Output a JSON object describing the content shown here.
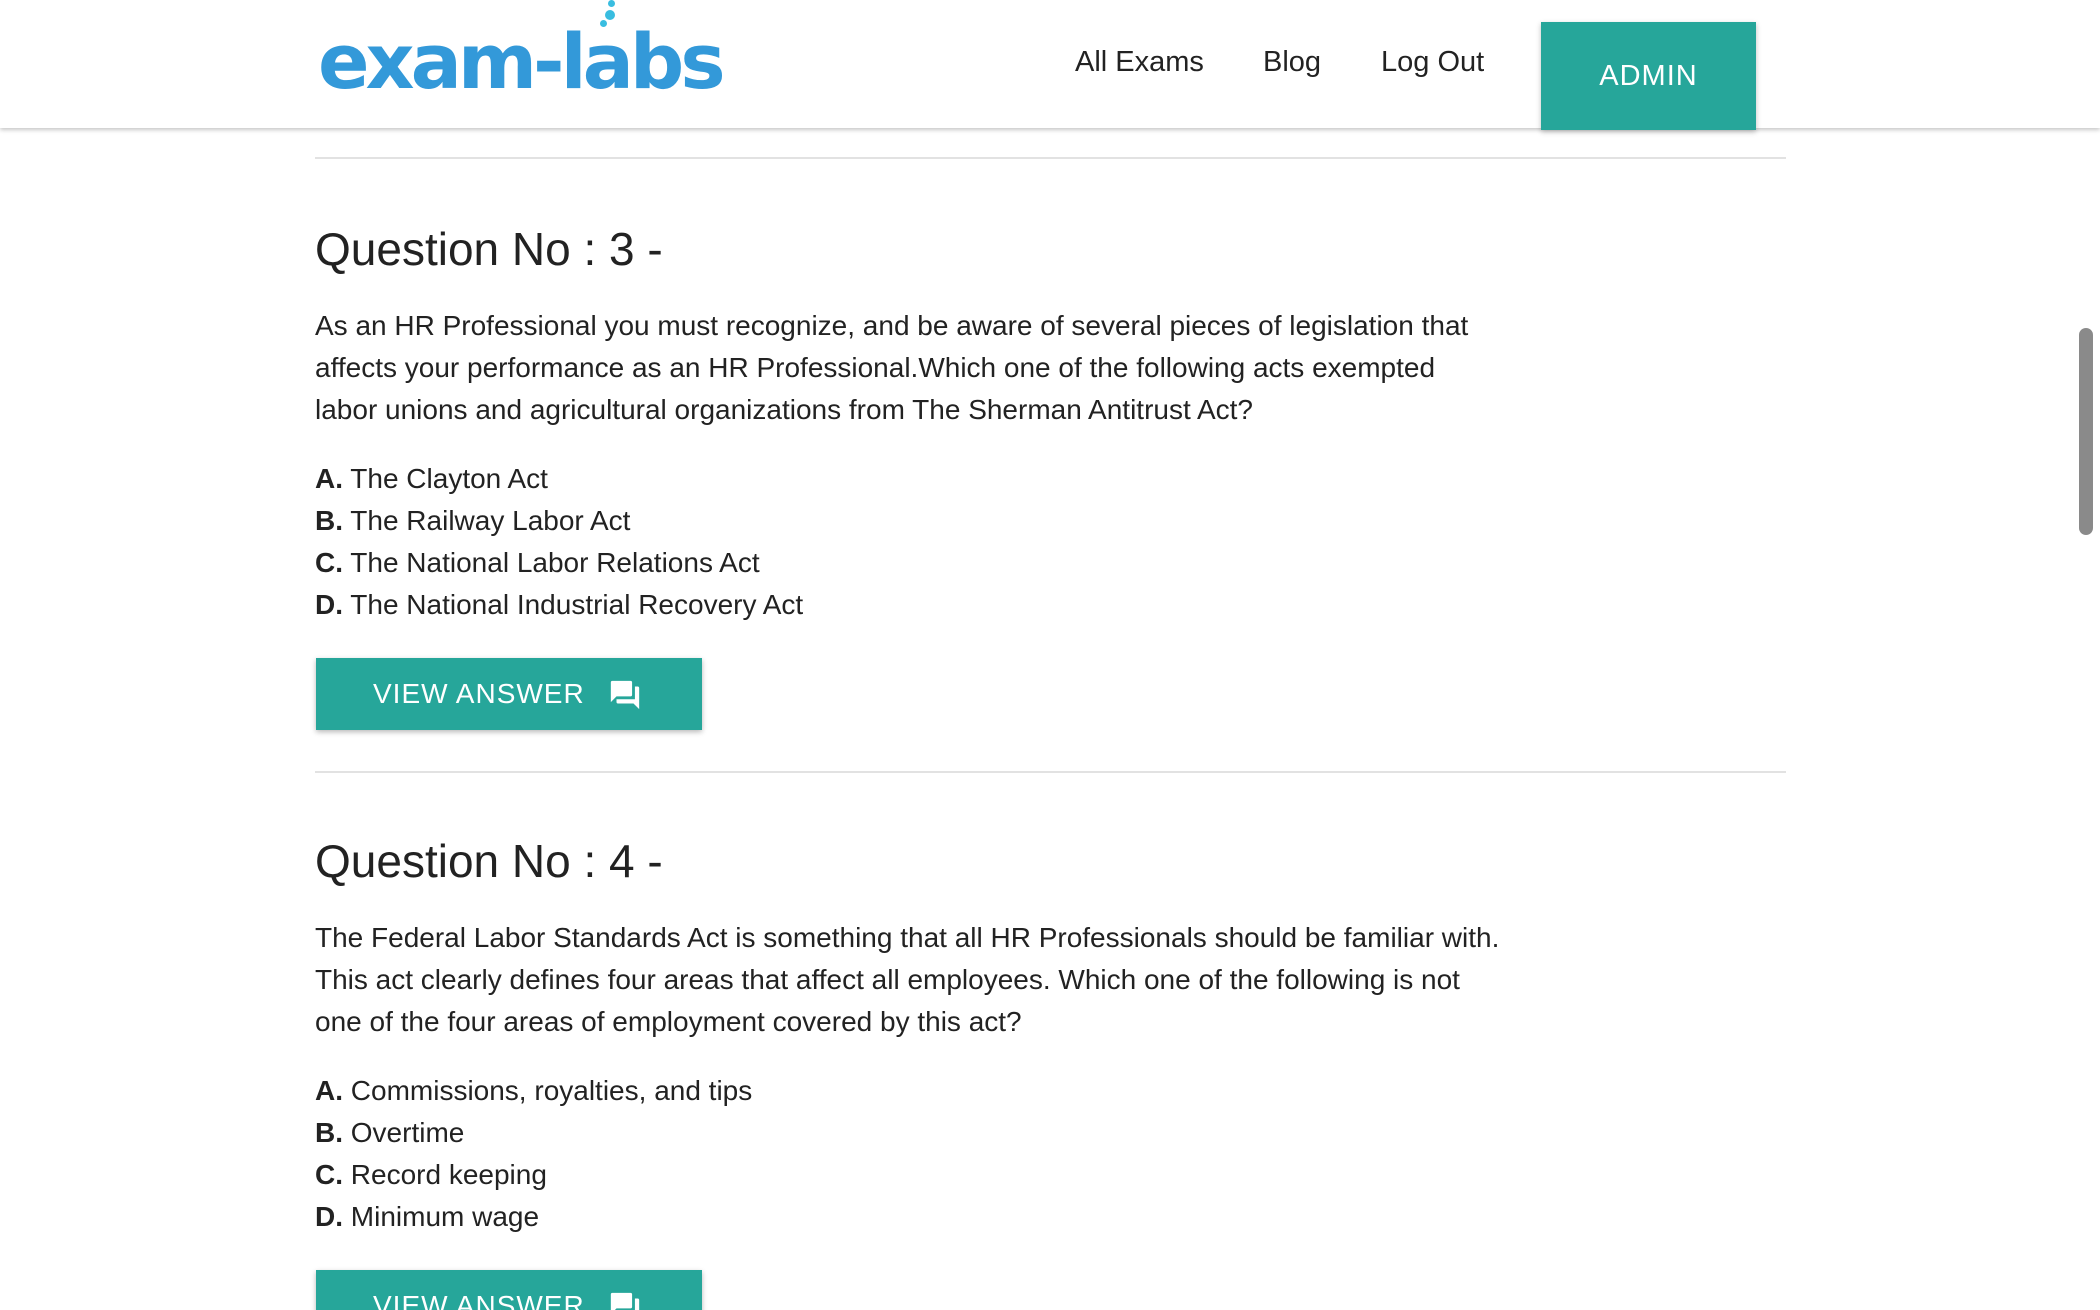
{
  "header": {
    "logo_text": "exam-labs",
    "nav": {
      "all_exams": "All Exams",
      "blog": "Blog",
      "log_out": "Log Out"
    },
    "admin_label": "ADMIN"
  },
  "questions": [
    {
      "title": "Question No : 3 -",
      "text": "As an HR Professional you must recognize, and be aware of several pieces of legislation that affects your performance as an HR Professional.Which one of the following acts exempted labor unions and agricultural organizations from The Sherman Antitrust Act?",
      "options": [
        {
          "letter": "A.",
          "text": "The Clayton Act"
        },
        {
          "letter": "B.",
          "text": "The Railway Labor Act"
        },
        {
          "letter": "C.",
          "text": "The National Labor Relations Act"
        },
        {
          "letter": "D.",
          "text": "The National Industrial Recovery Act"
        }
      ],
      "button_label": "VIEW ANSWER"
    },
    {
      "title": "Question No : 4 -",
      "text": "The Federal Labor Standards Act is something that all HR Professionals should be familiar with. This act clearly defines four areas that affect all employees. Which one of the following is not one of the four areas of employment covered by this act?",
      "options": [
        {
          "letter": "A.",
          "text": "Commissions, royalties, and tips"
        },
        {
          "letter": "B.",
          "text": "Overtime"
        },
        {
          "letter": "C.",
          "text": "Record keeping"
        },
        {
          "letter": "D.",
          "text": "Minimum wage"
        }
      ],
      "button_label": "VIEW ANSWER"
    }
  ],
  "icons": {
    "answer_button_icon": "forum-icon"
  },
  "colors": {
    "accent": "#26a69a",
    "logo": "#3399d9",
    "text": "#222222",
    "divider": "#e2e2e2"
  }
}
